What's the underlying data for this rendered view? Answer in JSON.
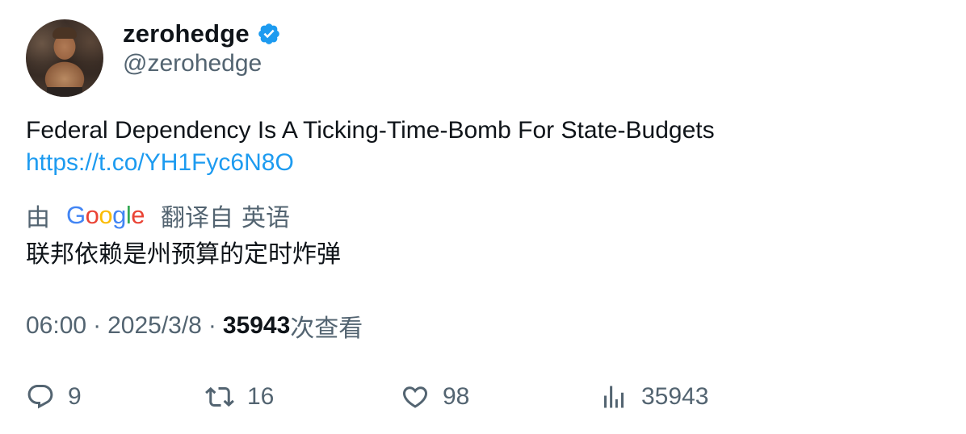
{
  "author": {
    "display_name": "zerohedge",
    "handle": "@zerohedge",
    "verified": true,
    "avatar_icon": "avatar-photo"
  },
  "tweet": {
    "text": "Federal Dependency Is A Ticking-Time-Bomb For State-Budgets",
    "link": "https://t.co/YH1Fyc6N8O"
  },
  "translation": {
    "by_label": "由",
    "provider": "Google",
    "from_label": "翻译自",
    "language": "英语",
    "translated_text": "联邦依赖是州预算的定时炸弹"
  },
  "meta": {
    "time": "06:00",
    "separator": "·",
    "date": "2025/3/8",
    "views_count": "35943",
    "views_label": "次查看"
  },
  "actions": {
    "replies": "9",
    "retweets": "16",
    "likes": "98",
    "views": "35943"
  },
  "colors": {
    "link": "#1d9bf0",
    "secondary_text": "#536471",
    "primary_text": "#0f1419",
    "verified_badge": "#1d9bf0"
  }
}
